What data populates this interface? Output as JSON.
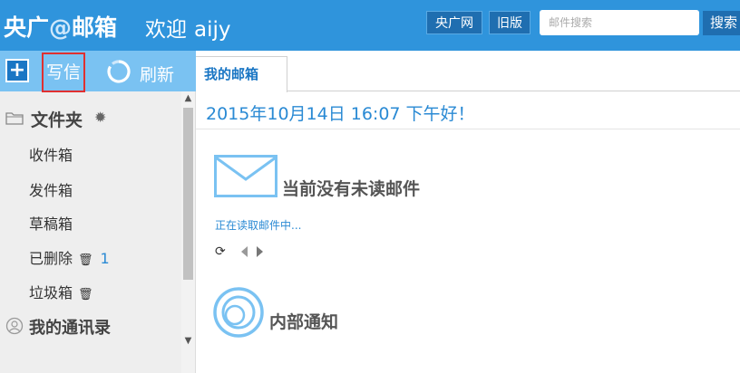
{
  "header": {
    "logo_part1": "央广",
    "logo_at": "@",
    "logo_part2": "邮箱",
    "welcome_label": "欢迎",
    "username": "aijy",
    "cctv_link": "央广网",
    "old_version_link": "旧版",
    "search_placeholder": "邮件搜索",
    "search_button": "搜索"
  },
  "toolbar": {
    "plus_label": "+",
    "compose_label": "写信",
    "refresh_label": "刷新"
  },
  "sidebar": {
    "folders_title": "文件夹",
    "items": [
      {
        "label": "收件箱"
      },
      {
        "label": "发件箱"
      },
      {
        "label": "草稿箱"
      },
      {
        "label": "已删除",
        "count": "1"
      },
      {
        "label": "垃圾箱"
      }
    ],
    "contacts_title": "我的通讯录"
  },
  "tabs": {
    "active_tab": "我的邮箱"
  },
  "main": {
    "greeting": "2015年10月14日 16:07   下午好！",
    "unread_title": "当前没有未读邮件",
    "loading_text": "正在读取邮件中...",
    "notice_title": "内部通知"
  },
  "colors": {
    "topbar": "#2f94dc",
    "toolbar": "#7ac2f2",
    "accent": "#2a8ad4",
    "highlight_border": "#e03030"
  },
  "icons": {
    "plus": "plus-icon",
    "refresh": "refresh-icon",
    "folder": "folder-icon",
    "gear": "gear-icon",
    "trash": "trash-icon",
    "contacts": "contacts-icon",
    "envelope": "envelope-icon",
    "sync": "sync-icon",
    "prev": "prev-arrow-icon",
    "next": "next-arrow-icon",
    "notice": "notice-icon"
  }
}
